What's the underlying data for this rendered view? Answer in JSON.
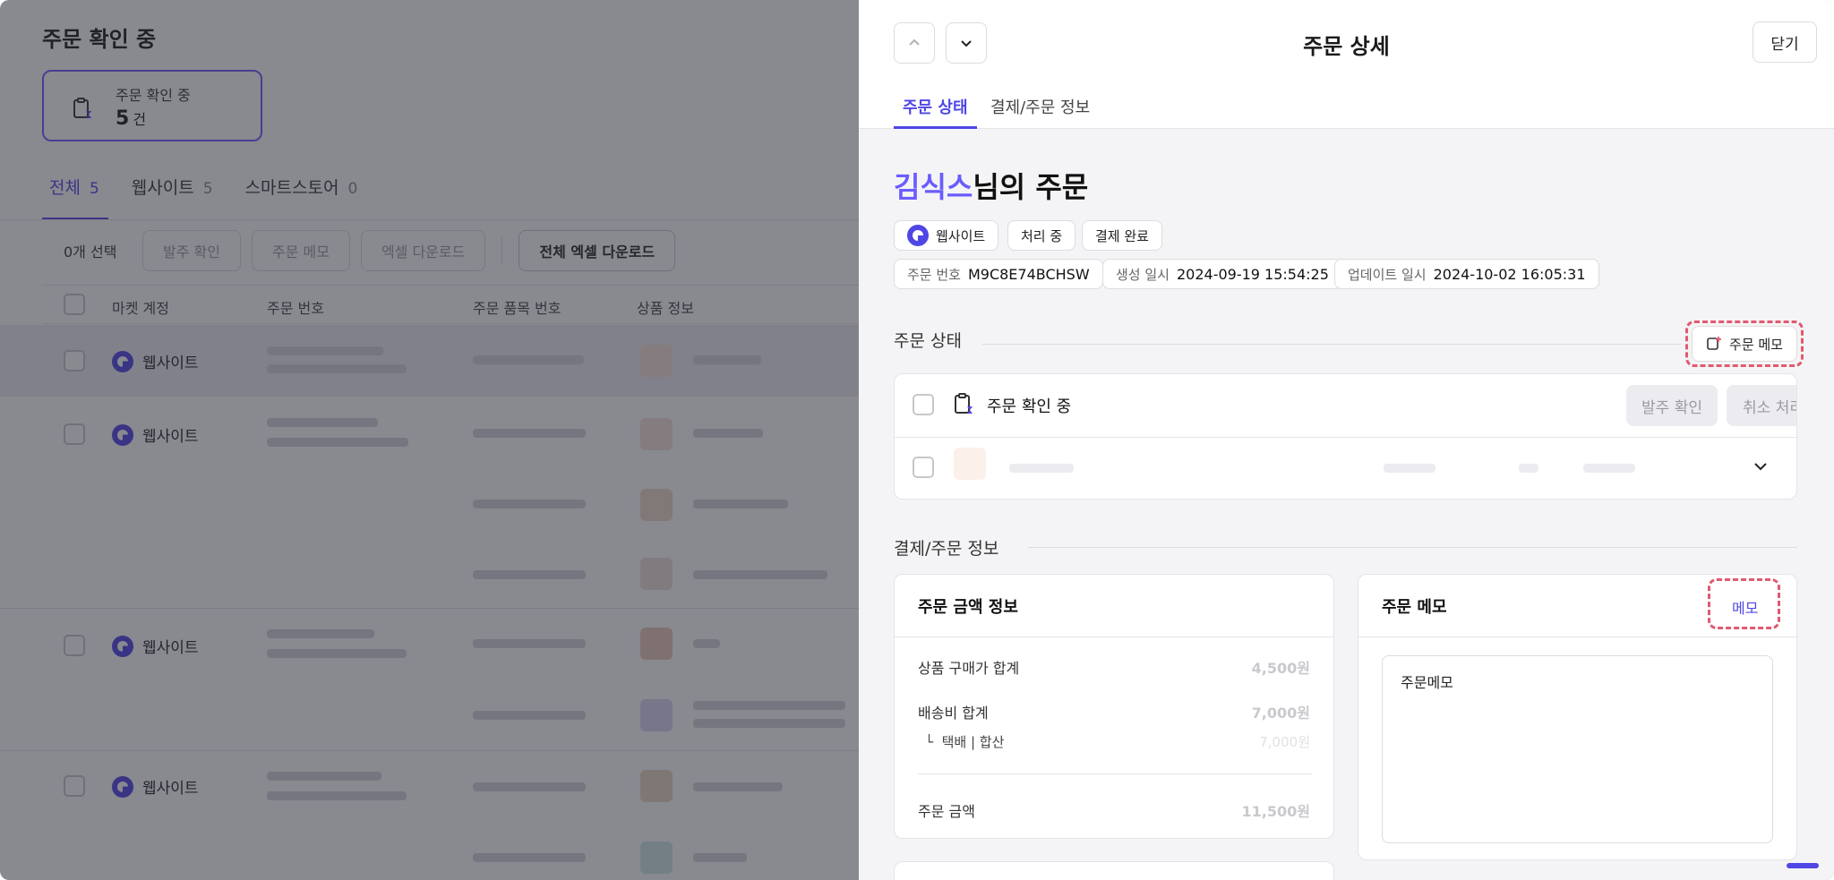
{
  "background": {
    "title": "주문 확인 중",
    "summary": {
      "label": "주문 확인 중",
      "count": "5",
      "unit": "건"
    },
    "tabs": [
      {
        "label": "전체",
        "count": "5"
      },
      {
        "label": "웹사이트",
        "count": "5"
      },
      {
        "label": "스마트스토어",
        "count": "0"
      }
    ],
    "toolbar": {
      "selected": "0개 선택",
      "confirm_label": "발주 확인",
      "memo_label": "주문 메모",
      "excel_label": "엑셀 다운로드",
      "all_excel_label": "전체 엑셀 다운로드"
    },
    "columns": [
      "마켓 계정",
      "주문 번호",
      "주문 품목 번호",
      "상품 정보"
    ],
    "rows": [
      {
        "store": "웹사이트"
      },
      {
        "store": "웹사이트"
      },
      {
        "store": "웹사이트"
      },
      {
        "store": "웹사이트"
      }
    ]
  },
  "panel": {
    "title": "주문 상세",
    "close_label": "닫기",
    "tabs": [
      "주문 상태",
      "결제/주문 정보"
    ],
    "customer_name": "김식스",
    "greeting_suffix": "님의 주문",
    "chips": {
      "channel": "웹사이트",
      "status": "처리 중",
      "payment": "결제 완료"
    },
    "meta": {
      "order_no_label": "주문 번호",
      "order_no": "M9C8E74BCHSW",
      "created_label": "생성 일시",
      "created": "2024-09-19 15:54:25",
      "updated_label": "업데이트 일시",
      "updated": "2024-10-02 16:05:31"
    },
    "order_status": {
      "section_title": "주문 상태",
      "memo_button": "주문 메모",
      "group_label": "주문 확인 중",
      "confirm_label": "발주 확인",
      "cancel_label": "취소 처리"
    },
    "payment": {
      "section_title": "결제/주문 정보",
      "amount_card": {
        "title": "주문 금액 정보",
        "product_total_label": "상품 구매가 합계",
        "product_total": "4,500원",
        "shipping_label": "배송비 합계",
        "shipping_total": "7,000원",
        "shipping_sub_label": "택배 | 합산",
        "shipping_sub": "7,000원",
        "order_total_label": "주문 금액",
        "order_total": "11,500원"
      },
      "memo_card": {
        "title": "주문 메모",
        "memo_button": "메모",
        "memo_text": "주문메모"
      }
    }
  },
  "colors": {
    "accent": "#4f46e5",
    "name": "#6b5cff",
    "highlight": "#e05a6e"
  }
}
